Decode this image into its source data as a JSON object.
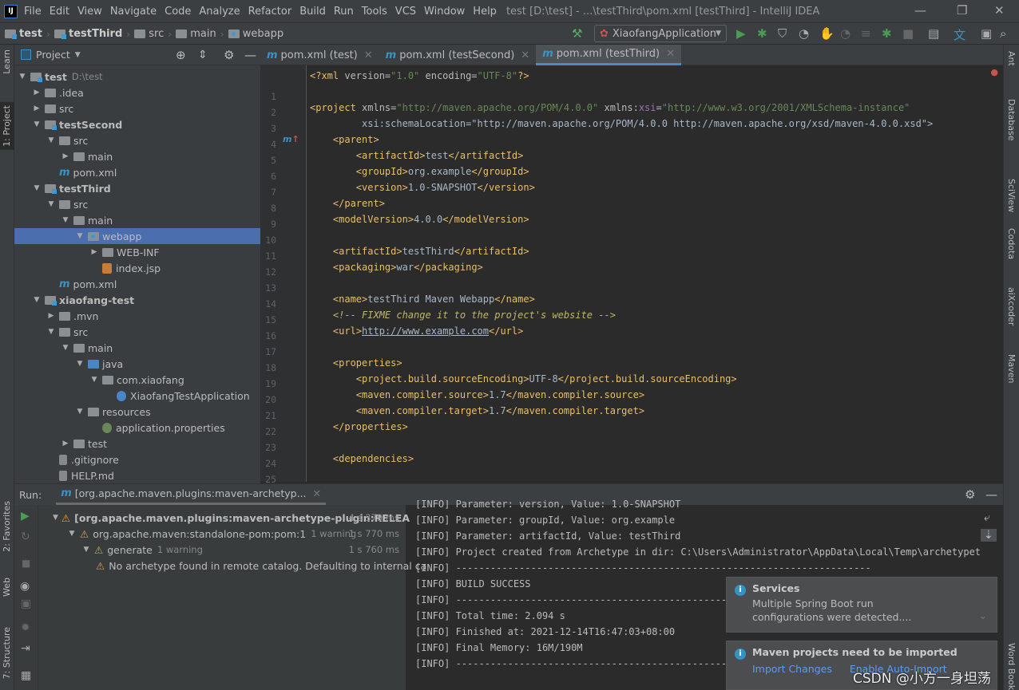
{
  "title_bar": {
    "logo": "IJ",
    "menu": [
      "File",
      "Edit",
      "View",
      "Navigate",
      "Code",
      "Analyze",
      "Refactor",
      "Build",
      "Run",
      "Tools",
      "VCS",
      "Window",
      "Help"
    ],
    "window_title": "test [D:\\test] - ...\\testThird\\pom.xml [testThird] - IntelliJ IDEA"
  },
  "breadcrumb": [
    "test",
    "testThird",
    "src",
    "main",
    "webapp"
  ],
  "toolbar": {
    "run_config": "XiaofangApplication"
  },
  "left_stripe": [
    "Learn",
    "1: Project",
    "2: Favorites",
    "Web",
    "7: Structure"
  ],
  "right_stripe": [
    "Ant",
    "Database",
    "SciView",
    "Codota",
    "aiXcoder",
    "Maven",
    "Word Book"
  ],
  "project": {
    "title": "Project",
    "tree": [
      {
        "label": "test",
        "hint": "D:\\test",
        "level": 0,
        "arrow": "down",
        "icon": "module",
        "bold": true
      },
      {
        "label": ".idea",
        "level": 1,
        "arrow": "right",
        "icon": "folder"
      },
      {
        "label": "src",
        "level": 1,
        "arrow": "right",
        "icon": "folder"
      },
      {
        "label": "testSecond",
        "level": 1,
        "arrow": "down",
        "icon": "module",
        "bold": true
      },
      {
        "label": "src",
        "level": 2,
        "arrow": "down",
        "icon": "folder"
      },
      {
        "label": "main",
        "level": 3,
        "arrow": "right",
        "icon": "folder"
      },
      {
        "label": "pom.xml",
        "level": 2,
        "arrow": "",
        "icon": "maven"
      },
      {
        "label": "testThird",
        "level": 1,
        "arrow": "down",
        "icon": "module",
        "bold": true
      },
      {
        "label": "src",
        "level": 2,
        "arrow": "down",
        "icon": "folder"
      },
      {
        "label": "main",
        "level": 3,
        "arrow": "down",
        "icon": "folder"
      },
      {
        "label": "webapp",
        "level": 4,
        "arrow": "down",
        "icon": "web",
        "selected": true
      },
      {
        "label": "WEB-INF",
        "level": 5,
        "arrow": "right",
        "icon": "folder"
      },
      {
        "label": "index.jsp",
        "level": 5,
        "arrow": "",
        "icon": "jsp"
      },
      {
        "label": "pom.xml",
        "level": 2,
        "arrow": "",
        "icon": "maven"
      },
      {
        "label": "xiaofang-test",
        "level": 1,
        "arrow": "down",
        "icon": "module",
        "bold": true
      },
      {
        "label": ".mvn",
        "level": 2,
        "arrow": "right",
        "icon": "folder"
      },
      {
        "label": "src",
        "level": 2,
        "arrow": "down",
        "icon": "folder"
      },
      {
        "label": "main",
        "level": 3,
        "arrow": "down",
        "icon": "folder"
      },
      {
        "label": "java",
        "level": 4,
        "arrow": "down",
        "icon": "source"
      },
      {
        "label": "com.xiaofang",
        "level": 5,
        "arrow": "down",
        "icon": "package"
      },
      {
        "label": "XiaofangTestApplication",
        "level": 6,
        "arrow": "",
        "icon": "spring-class"
      },
      {
        "label": "resources",
        "level": 4,
        "arrow": "down",
        "icon": "resources"
      },
      {
        "label": "application.properties",
        "level": 5,
        "arrow": "",
        "icon": "properties"
      },
      {
        "label": "test",
        "level": 3,
        "arrow": "right",
        "icon": "folder"
      },
      {
        "label": ".gitignore",
        "level": 2,
        "arrow": "",
        "icon": "file"
      },
      {
        "label": "HELP.md",
        "level": 2,
        "arrow": "",
        "icon": "markdown"
      }
    ]
  },
  "editor": {
    "tabs": [
      {
        "label": "pom.xml (test)"
      },
      {
        "label": "pom.xml (testSecond)"
      },
      {
        "label": "pom.xml (testThird)",
        "active": true
      }
    ],
    "lines": [
      "<?xml version=\"1.0\" encoding=\"UTF-8\"?>",
      "",
      "<project xmlns=\"http://maven.apache.org/POM/4.0.0\" xmlns:xsi=\"http://www.w3.org/2001/XMLSchema-instance\"",
      "         xsi:schemaLocation=\"http://maven.apache.org/POM/4.0.0 http://maven.apache.org/xsd/maven-4.0.0.xsd\">",
      "    <parent>",
      "        <artifactId>test</artifactId>",
      "        <groupId>org.example</groupId>",
      "        <version>1.0-SNAPSHOT</version>",
      "    </parent>",
      "    <modelVersion>4.0.0</modelVersion>",
      "",
      "    <artifactId>testThird</artifactId>",
      "    <packaging>war</packaging>",
      "",
      "    <name>testThird Maven Webapp</name>",
      "    <!-- FIXME change it to the project's website -->",
      "    <url>http://www.example.com</url>",
      "",
      "    <properties>",
      "        <project.build.sourceEncoding>UTF-8</project.build.sourceEncoding>",
      "        <maven.compiler.source>1.7</maven.compiler.source>",
      "        <maven.compiler.target>1.7</maven.compiler.target>",
      "    </properties>",
      "",
      "    <dependencies>"
    ]
  },
  "run": {
    "label": "Run:",
    "tab": "[org.apache.maven.plugins:maven-archetyp...",
    "tree": [
      {
        "text": "[org.apache.maven.plugins:maven-archetype-plugin:RELEA",
        "time": "4 s 379 ms",
        "bold": true
      },
      {
        "text": "org.apache.maven:standalone-pom:pom:1",
        "hint": "1 warning",
        "time": "1 s 770 ms"
      },
      {
        "text": "generate",
        "hint": "1 warning",
        "time": "1 s 760 ms"
      },
      {
        "text": "No archetype found in remote catalog. Defaulting to internal ca"
      }
    ],
    "console": [
      "[INFO] Parameter: version, Value: 1.0-SNAPSHOT",
      "[INFO] Parameter: groupId, Value: org.example",
      "[INFO] Parameter: artifactId, Value: testThird",
      "[INFO] Project created from Archetype in dir: C:\\Users\\Administrator\\AppData\\Local\\Temp\\archetypetmp\\",
      "[INFO] ------------------------------------------------------------------------",
      "[INFO] BUILD SUCCESS",
      "[INFO] ------------------------------------------------------------------------",
      "[INFO] Total time: 2.094 s",
      "[INFO] Finished at: 2021-12-14T16:47:03+08:00",
      "[INFO] Final Memory: 16M/190M",
      "[INFO] ------------------------------------------------------------------------"
    ]
  },
  "notifications": [
    {
      "title": "Services",
      "body": "Multiple Spring Boot run configurations were detected...."
    },
    {
      "title": "Maven projects need to be imported",
      "links": [
        "Import Changes",
        "Enable Auto-Import"
      ]
    }
  ],
  "watermark": "CSDN @小方一身坦荡",
  "colors": {
    "accent": "#4a88c7",
    "selection": "#4b6eaf",
    "warning": "#e2a53a",
    "link": "#589df6"
  }
}
